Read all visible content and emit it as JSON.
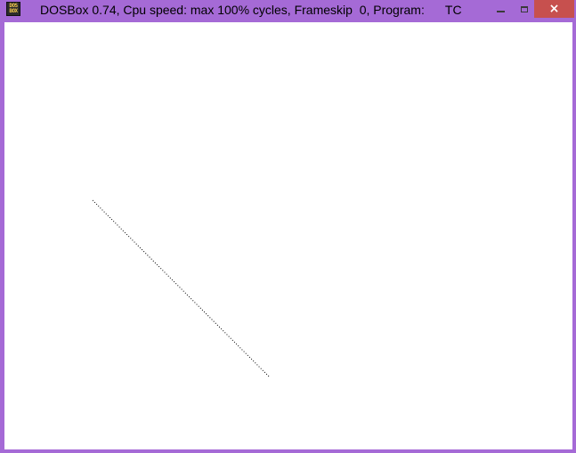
{
  "window": {
    "title": "DOSBox 0.74, Cpu speed: max 100% cycles, Frameskip  0, Program:      TC",
    "icon": "dosbox-icon",
    "icon_text_top": "DOS",
    "icon_text_bottom": "BOX",
    "buttons": {
      "minimize": "minimize-icon",
      "maximize": "maximize-icon",
      "close": "×"
    }
  },
  "colors": {
    "title_bar": "#a56ad6",
    "close_button": "#c7504e",
    "canvas_background": "#ffffff",
    "line": "#000000"
  },
  "canvas": {
    "content": "dotted-line"
  }
}
